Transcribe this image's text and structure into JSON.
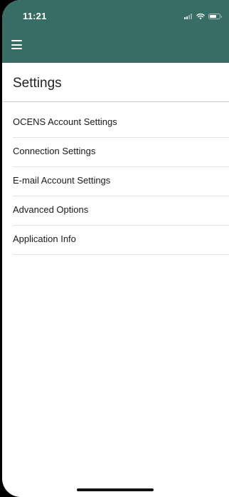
{
  "status_bar": {
    "time": "11:21"
  },
  "header": {
    "background_color": "#376d65",
    "menu_icon": "hamburger-menu-icon"
  },
  "page": {
    "title": "Settings"
  },
  "settings_items": [
    {
      "label": "OCENS Account Settings"
    },
    {
      "label": "Connection Settings"
    },
    {
      "label": "E-mail Account Settings"
    },
    {
      "label": "Advanced Options"
    },
    {
      "label": "Application Info"
    }
  ]
}
